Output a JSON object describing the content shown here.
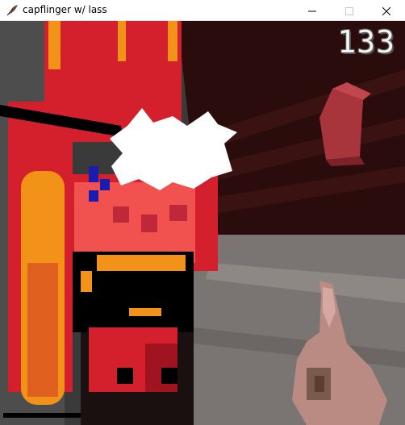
{
  "window": {
    "title": "capflinger w/ lass",
    "icon": "feather-quill-icon",
    "controls": [
      "minimize-icon",
      "maximize-icon",
      "close-icon"
    ]
  },
  "hud": {
    "score": "133"
  },
  "colors": {
    "enemy_red": "#d3202c",
    "enemy_orange": "#f39219",
    "enemy_pink": "#f2524f",
    "wall_dark": "#2a0c0c",
    "floor_grey": "#7a7572",
    "flash_white": "#ffffff",
    "crate_red": "#a8353b",
    "hand_skin": "#b98b83"
  }
}
